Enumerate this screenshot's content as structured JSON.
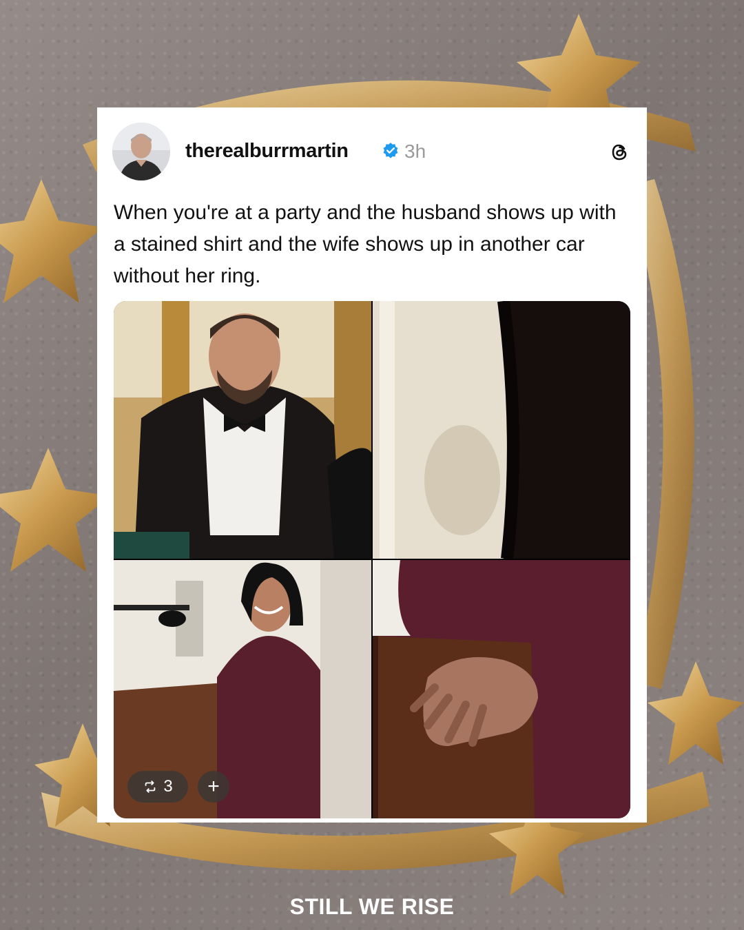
{
  "post": {
    "username": "therealburrmartin",
    "timestamp": "3h",
    "text": "When you're at a party and the husband shows up with a stained shirt and the wife shows up in another car without her ring.",
    "repost_count": "3",
    "plus_label": "+"
  },
  "icons": {
    "verified": "verified-badge-icon",
    "threads": "threads-logo-icon",
    "repost": "repost-icon"
  },
  "footer": {
    "brand": "STILL WE RISE"
  },
  "colors": {
    "background": "#8a817e",
    "card": "#ffffff",
    "verified_blue": "#1d9bf0",
    "gold": "#c99a4e"
  }
}
